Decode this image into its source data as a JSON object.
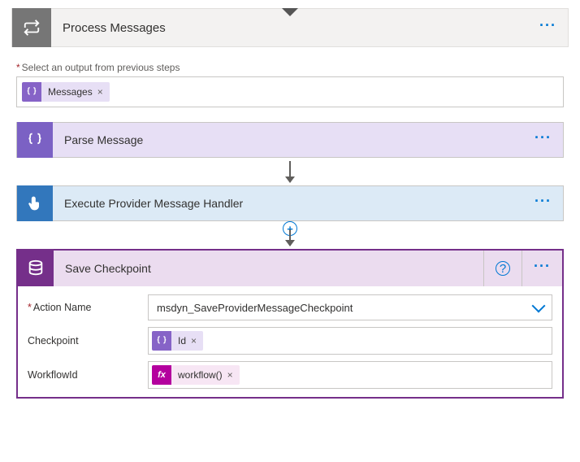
{
  "header": {
    "title": "Process Messages"
  },
  "output_section": {
    "label": "Select an output from previous steps",
    "token": {
      "label": "Messages"
    }
  },
  "steps": {
    "parse": {
      "title": "Parse Message"
    },
    "execute": {
      "title": "Execute Provider Message Handler"
    },
    "save": {
      "title": "Save Checkpoint"
    }
  },
  "save_fields": {
    "action_name": {
      "label": "Action Name",
      "value": "msdyn_SaveProviderMessageCheckpoint"
    },
    "checkpoint": {
      "label": "Checkpoint",
      "token": "Id"
    },
    "workflow": {
      "label": "WorkflowId",
      "token": "workflow()"
    }
  }
}
